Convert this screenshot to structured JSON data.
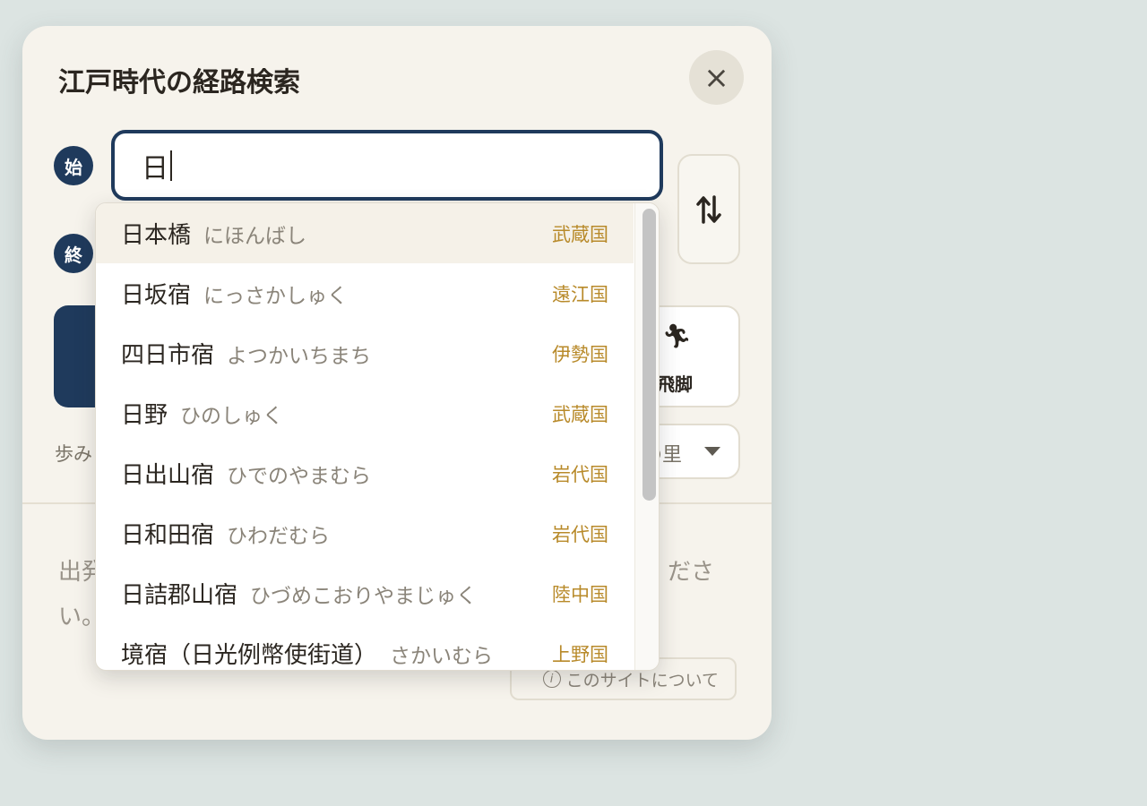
{
  "header": {
    "title": "江戸時代の経路検索",
    "close_label": "×"
  },
  "origin": {
    "badge": "始",
    "value": "日"
  },
  "destination": {
    "badge": "終"
  },
  "swap": {
    "icon": "swap-vertical-icon"
  },
  "modes": {
    "secondary_label": "飛脚",
    "secondary_icon": "runner-icon"
  },
  "pace": {
    "label": "歩み",
    "value": "の里"
  },
  "hint": {
    "left": "出発",
    "left2": "い。",
    "right": "ださ"
  },
  "about": {
    "label": "このサイトについて",
    "icon": "info-icon"
  },
  "suggestions": [
    {
      "name": "日本橋",
      "kana": "にほんばし",
      "province": "武蔵国"
    },
    {
      "name": "日坂宿",
      "kana": "にっさかしゅく",
      "province": "遠江国"
    },
    {
      "name": "四日市宿",
      "kana": "よつかいちまち",
      "province": "伊勢国"
    },
    {
      "name": "日野",
      "kana": "ひのしゅく",
      "province": "武蔵国"
    },
    {
      "name": "日出山宿",
      "kana": "ひでのやまむら",
      "province": "岩代国"
    },
    {
      "name": "日和田宿",
      "kana": "ひわだむら",
      "province": "岩代国"
    },
    {
      "name": "日詰郡山宿",
      "kana": "ひづめこおりやまじゅく",
      "province": "陸中国"
    },
    {
      "name": "境宿（日光例幣使街道）",
      "kana": "さかいむら",
      "province": "上野国"
    }
  ],
  "colors": {
    "accent": "#1f3a5c",
    "province": "#b88a2a",
    "panel": "#f6f3ec"
  }
}
